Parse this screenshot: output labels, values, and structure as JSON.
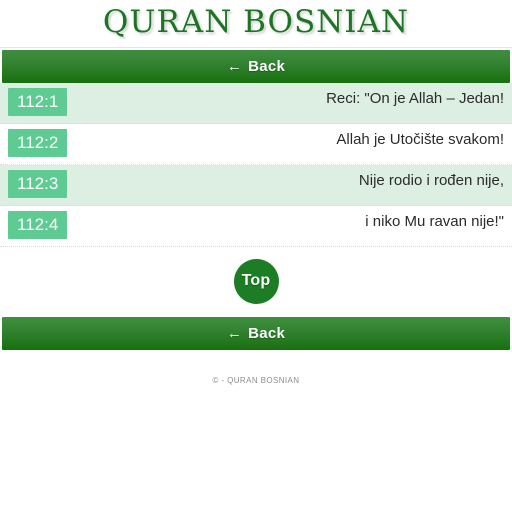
{
  "header": {
    "title": "QURAN BOSNIAN"
  },
  "nav": {
    "back_arrow": "←",
    "back_label": "Back"
  },
  "verses": [
    {
      "ref": "112:1",
      "text": "Reci: \"On je Allah – Jedan!"
    },
    {
      "ref": "112:2",
      "text": "Allah je Utočište svakom!"
    },
    {
      "ref": "112:3",
      "text": "Nije rodio i rođen nije,"
    },
    {
      "ref": "112:4",
      "text": "i niko Mu ravan nije!\""
    }
  ],
  "top_button": {
    "label": "Top"
  },
  "footer": {
    "text": "© - QURAN BOSNIAN"
  },
  "colors": {
    "title_green": "#1d7524",
    "bar_green_top": "#3f8f3f",
    "bar_green_bottom": "#18700f",
    "badge_green": "#5ecb93",
    "row_alt_bg": "#ddeee2",
    "top_button_green": "#1d7d24"
  }
}
